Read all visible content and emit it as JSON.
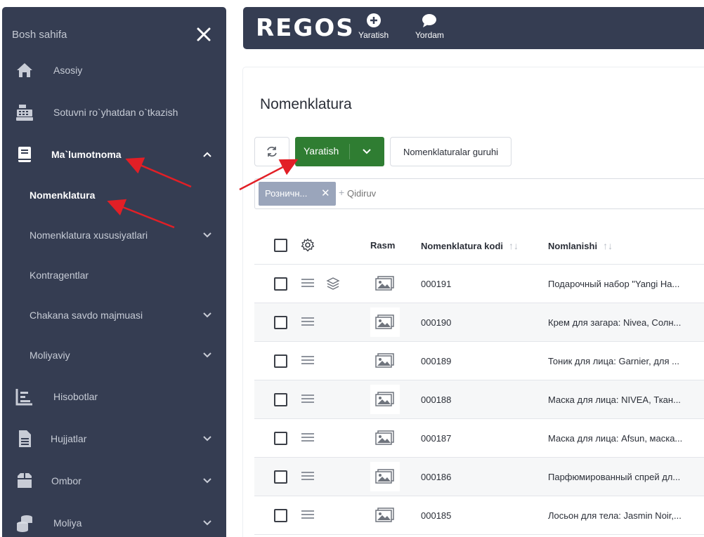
{
  "sidebar": {
    "title": "Bosh sahifa",
    "items": [
      {
        "label": "Asosiy"
      },
      {
        "label": "Sotuvni ro`yhatdan o`tkazish"
      },
      {
        "label": "Ma`lumotnoma"
      },
      {
        "label": "Nomenklatura"
      },
      {
        "label": "Nomenklatura xususiyatlari"
      },
      {
        "label": "Kontragentlar"
      },
      {
        "label": "Chakana savdo majmuasi"
      },
      {
        "label": "Moliyaviy"
      },
      {
        "label": "Hisobotlar"
      },
      {
        "label": "Hujjatlar"
      },
      {
        "label": "Ombor"
      },
      {
        "label": "Moliya"
      }
    ]
  },
  "topbar": {
    "logo": "REGOS",
    "create_label": "Yaratish",
    "help_label": "Yordam"
  },
  "main": {
    "title": "Nomenklatura",
    "create_button": "Yaratish",
    "group_button": "Nomenklaturalar guruhi",
    "filter_chip": "Розничн...",
    "search_placeholder": "Qidiruv",
    "columns": {
      "image": "Rasm",
      "code": "Nomenklatura kodi",
      "name": "Nomlanishi"
    },
    "rows": [
      {
        "code": "000191",
        "name": "Подарочный набор \"Yangi Ha..."
      },
      {
        "code": "000190",
        "name": "Крем для загара: Nivea, Солн..."
      },
      {
        "code": "000189",
        "name": "Тоник для лица: Garnier, для ..."
      },
      {
        "code": "000188",
        "name": "Маска для лица: NIVEA, Ткан..."
      },
      {
        "code": "000187",
        "name": "Маска для лица: Afsun, маска..."
      },
      {
        "code": "000186",
        "name": "Парфюмированный спрей дл..."
      },
      {
        "code": "000185",
        "name": "Лосьон для тела: Jasmin Noir,..."
      }
    ]
  },
  "colors": {
    "sidebar_bg": "#353d52",
    "primary_green": "#2f7d32",
    "chip_bg": "#9aa5bb",
    "annotation_red": "#e21f26"
  }
}
